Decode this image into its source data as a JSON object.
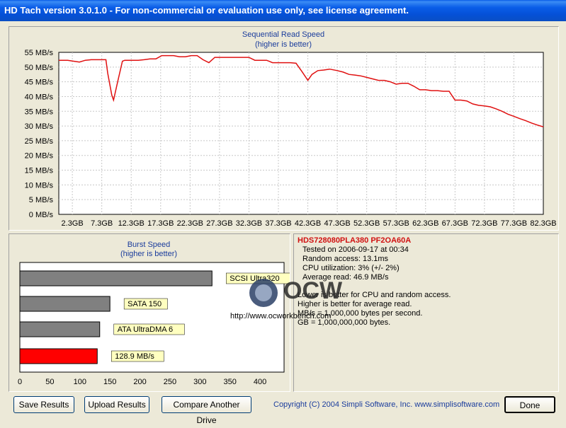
{
  "window": {
    "title": "HD Tach version 3.0.1.0  - For non-commercial or evaluation use only, see license agreement."
  },
  "chart_data": [
    {
      "type": "line",
      "title": "Sequential Read Speed",
      "subtitle": "(higher is better)",
      "ylabel": "",
      "xlabel": "",
      "y_ticks": [
        "0 MB/s",
        "5 MB/s",
        "10 MB/s",
        "15 MB/s",
        "20 MB/s",
        "25 MB/s",
        "30 MB/s",
        "35 MB/s",
        "40 MB/s",
        "45 MB/s",
        "50 MB/s",
        "55 MB/s"
      ],
      "x_ticks": [
        "2.3GB",
        "7.3GB",
        "12.3GB",
        "17.3GB",
        "22.3GB",
        "27.3GB",
        "32.3GB",
        "37.3GB",
        "42.3GB",
        "47.3GB",
        "52.3GB",
        "57.3GB",
        "62.3GB",
        "67.3GB",
        "72.3GB",
        "77.3GB",
        "82.3GB"
      ],
      "ylim": [
        0,
        55
      ],
      "xlim": [
        0,
        82.3
      ],
      "grid": true,
      "series": [
        {
          "color": "#e01010",
          "x": [
            0,
            1.5,
            2.5,
            3.5,
            4.5,
            5.5,
            6.5,
            7.3,
            8.0,
            8.3,
            9.0,
            9.3,
            10.0,
            10.8,
            11.2,
            12.3,
            13.5,
            14.5,
            15.5,
            16.5,
            17.5,
            18.5,
            19.5,
            20.5,
            21.5,
            22.5,
            23.5,
            24.5,
            25.5,
            26.5,
            27.3,
            28.3,
            29.3,
            30.3,
            31.3,
            32.3,
            33.3,
            34.3,
            35.3,
            36.3,
            37.3,
            38.3,
            39.3,
            40.3,
            41.3,
            42.3,
            43.0,
            44.0,
            45.0,
            46.0,
            47.3,
            48.3,
            49.3,
            50.3,
            51.3,
            52.3,
            53.3,
            54.3,
            55.3,
            56.3,
            57.3,
            58.3,
            59.3,
            60.3,
            61.3,
            62.3,
            63.3,
            64.3,
            65.3,
            66.3,
            67.3,
            68.3,
            69.3,
            70.3,
            71.3,
            72.3,
            73.3,
            74.3,
            75.3,
            76.3,
            77.3,
            78.3,
            79.3,
            80.3,
            81.3,
            82.3
          ],
          "y": [
            52.3,
            52.3,
            52.0,
            51.7,
            52.3,
            52.5,
            52.5,
            52.5,
            52.5,
            48.0,
            40.5,
            38.8,
            45.0,
            52.0,
            52.3,
            52.3,
            52.3,
            52.5,
            52.8,
            52.8,
            53.9,
            53.9,
            53.9,
            53.5,
            53.5,
            53.9,
            53.9,
            52.5,
            51.5,
            53.3,
            53.3,
            53.3,
            53.3,
            53.3,
            53.3,
            53.3,
            52.3,
            52.3,
            52.3,
            51.5,
            51.5,
            51.5,
            51.5,
            51.3,
            48.5,
            45.5,
            47.5,
            48.8,
            49.0,
            49.3,
            48.8,
            48.3,
            47.5,
            47.3,
            47.0,
            46.5,
            46.0,
            45.5,
            45.5,
            45.0,
            44.2,
            44.5,
            44.5,
            43.5,
            42.3,
            42.3,
            42.0,
            42.0,
            41.8,
            41.8,
            38.8,
            38.8,
            38.5,
            37.5,
            37.0,
            36.8,
            36.5,
            35.8,
            35.0,
            34.0,
            33.3,
            32.5,
            31.8,
            31.0,
            30.3,
            29.7
          ]
        }
      ]
    },
    {
      "type": "bar",
      "title": "Burst Speed",
      "subtitle": "(higher is better)",
      "x_ticks": [
        "0",
        "50",
        "100",
        "150",
        "200",
        "250",
        "300",
        "350",
        "400"
      ],
      "xlim": [
        0,
        440
      ],
      "bars": [
        {
          "value": 320,
          "label": "SCSI Ultra320",
          "color": "#808080"
        },
        {
          "value": 150,
          "label": "SATA 150",
          "color": "#808080"
        },
        {
          "value": 133,
          "label": "ATA UltraDMA 6",
          "color": "#808080"
        },
        {
          "value": 128.9,
          "label": "128.9 MB/s",
          "color": "#ff0000"
        }
      ]
    }
  ],
  "info": {
    "drive": "HDS728080PLA380 PF2OA60A",
    "lines": [
      "Tested on 2006-09-17 at 00:34",
      "Random access: 13.1ms",
      "CPU utilization: 3% (+/- 2%)",
      "Average read: 46.9 MB/s"
    ],
    "notes": [
      "Lower is better for CPU and random access.",
      "Higher is better for average read.",
      "MB/s = 1,000,000 bytes per second.",
      "GB = 1,000,000,000 bytes."
    ]
  },
  "watermark": {
    "logo": "OCW",
    "url": "http://www.ocworkbench.com"
  },
  "buttons": {
    "save": "Save Results",
    "upload": "Upload Results",
    "compare": "Compare Another Drive",
    "done": "Done"
  },
  "footer": {
    "copyright": "Copyright (C) 2004 Simpli Software, Inc. www.simplisoftware.com"
  }
}
